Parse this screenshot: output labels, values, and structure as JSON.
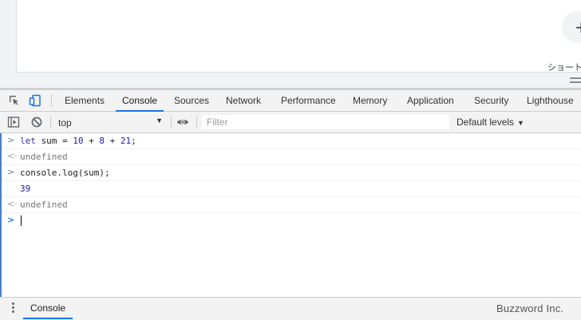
{
  "page": {
    "shortcut_label": "ショートカット",
    "newtab_plus": "+"
  },
  "devtools": {
    "tabs": [
      {
        "label": "Elements"
      },
      {
        "label": "Console"
      },
      {
        "label": "Sources"
      },
      {
        "label": "Network"
      },
      {
        "label": "Performance"
      },
      {
        "label": "Memory"
      },
      {
        "label": "Application"
      },
      {
        "label": "Security"
      },
      {
        "label": "Lighthouse"
      }
    ],
    "active_tab": "Console",
    "console_toolbar": {
      "context": "top",
      "filter_placeholder": "Filter",
      "levels": "Default levels"
    },
    "console_lines": [
      {
        "type": "input",
        "gutter": ">",
        "tokens": [
          {
            "t": "let ",
            "c": "kw"
          },
          {
            "t": "sum = ",
            "c": "ident"
          },
          {
            "t": "10",
            "c": "num"
          },
          {
            "t": " + ",
            "c": "ident"
          },
          {
            "t": "8",
            "c": "num"
          },
          {
            "t": " + ",
            "c": "ident"
          },
          {
            "t": "21",
            "c": "num"
          },
          {
            "t": ";",
            "c": "ident"
          }
        ]
      },
      {
        "type": "result",
        "gutter": "<·",
        "text": "undefined"
      },
      {
        "type": "input",
        "gutter": ">",
        "text": "console.log(sum);"
      },
      {
        "type": "log",
        "gutter": "",
        "text": "39"
      },
      {
        "type": "result",
        "gutter": "<·",
        "text": "undefined"
      }
    ],
    "prompt_symbol": ">",
    "drawer": {
      "tab_label": "Console"
    },
    "watermark": "Buzzword Inc."
  },
  "colors": {
    "accent": "#1a73e8",
    "toolbar_bg": "#f3f3f3",
    "keyword": "#2e33a4",
    "number": "#1c1cb5"
  }
}
